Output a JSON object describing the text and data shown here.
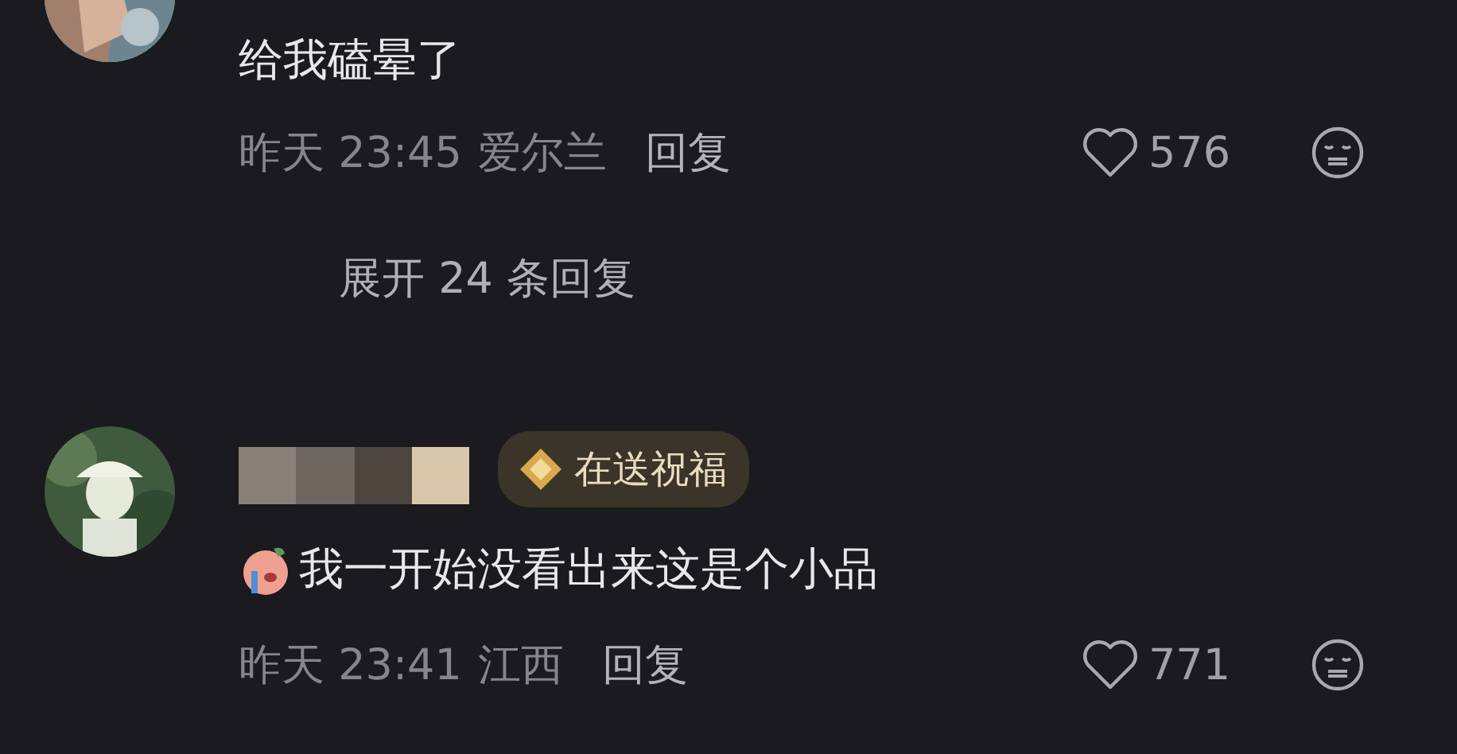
{
  "comments": [
    {
      "text": "给我磕晕了",
      "time": "昨天 23:45",
      "location": "爱尔兰",
      "reply": "回复",
      "likes": "576",
      "replies_toggle": "展开 24 条回复"
    },
    {
      "name_hidden": true,
      "badge": "在送祝福",
      "sticker": true,
      "text": "我一开始没看出来这是个小品",
      "time": "昨天 23:41",
      "location": "江西",
      "reply": "回复",
      "likes": "771"
    }
  ]
}
